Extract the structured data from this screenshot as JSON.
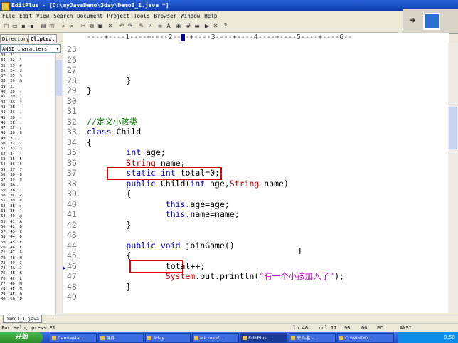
{
  "window": {
    "title": "EditPlus - [D:\\myJavaDemo\\3day\\Demo3_1.java *]"
  },
  "menu": [
    "File",
    "Edit",
    "View",
    "Search",
    "Document",
    "Project",
    "Tools",
    "Browser",
    "Window",
    "Help"
  ],
  "sidebar": {
    "tabs": [
      "Directory",
      "Cliptext"
    ],
    "selector": "ANSI characters",
    "list": [
      "33 (21) !",
      "34 (22) \"",
      "35 (23) #",
      "36 (24) $",
      "37 (25) %",
      "38 (26) &",
      "39 (27) '",
      "40 (28) (",
      "41 (29) )",
      "42 (2A) *",
      "43 (2B) +",
      "44 (2C) ,",
      "45 (2D) -",
      "46 (2E) .",
      "47 (2F) /",
      "48 (30) 0",
      "49 (31) 1",
      "50 (32) 2",
      "51 (33) 3",
      "52 (34) 4",
      "53 (35) 5",
      "54 (36) 6",
      "55 (37) 7",
      "56 (38) 8",
      "57 (39) 9",
      "58 (3A) :",
      "59 (3B) ;",
      "60 (3C) <",
      "61 (3D) =",
      "62 (3E) >",
      "63 (3F) ?",
      "64 (40) @",
      "65 (41) A",
      "66 (42) B",
      "67 (43) C",
      "68 (44) D",
      "69 (45) E",
      "70 (46) F",
      "71 (47) G",
      "72 (48) H",
      "73 (49) I",
      "74 (4A) J",
      "75 (4B) K",
      "76 (4C) L",
      "77 (4D) M",
      "78 (4E) N",
      "79 (4F) O",
      "80 (50) P"
    ]
  },
  "ruler": "----+----1----+----2----+----3----+----4----+----5----+----6--",
  "code_lines": [
    {
      "n": "25",
      "t": ""
    },
    {
      "n": "26",
      "t": ""
    },
    {
      "n": "27",
      "t": ""
    },
    {
      "n": "28",
      "t": "        }"
    },
    {
      "n": "29",
      "t": "}"
    },
    {
      "n": "30",
      "t": ""
    },
    {
      "n": "31",
      "t": ""
    },
    {
      "n": "32",
      "t": "//定义小孩类"
    },
    {
      "n": "33",
      "t": "class Child"
    },
    {
      "n": "34",
      "t": "{"
    },
    {
      "n": "35",
      "t": "        int age;"
    },
    {
      "n": "36",
      "t": "        String name;"
    },
    {
      "n": "37",
      "t": "        static int total=0;"
    },
    {
      "n": "38",
      "t": "        public Child(int age,String name)"
    },
    {
      "n": "39",
      "t": "        {"
    },
    {
      "n": "40",
      "t": "                this.age=age;"
    },
    {
      "n": "41",
      "t": "                this.name=name;"
    },
    {
      "n": "42",
      "t": "        }"
    },
    {
      "n": "43",
      "t": ""
    },
    {
      "n": "44",
      "t": "        public void joinGame()"
    },
    {
      "n": "45",
      "t": "        {"
    },
    {
      "n": "46",
      "t": "                total++;"
    },
    {
      "n": "47",
      "t": "                System.out.println(\"有一个小孩加入了\");"
    },
    {
      "n": "48",
      "t": "        }"
    },
    {
      "n": "49",
      "t": ""
    }
  ],
  "file_tab": "Demo3_1.java",
  "status": {
    "help": "For Help, press F1",
    "ln": "ln 46",
    "col": "col 17",
    "num": "90",
    "ins": "00",
    "mode": "PC",
    "enc": "ANSI"
  },
  "taskbar": {
    "start": "开始",
    "tasks": [
      "Camtasia...",
      "课件",
      "3day",
      "Microsof...",
      "EditPlus...",
      "未命名 -...",
      "C:\\WINDO..."
    ],
    "clock": "9:58"
  }
}
